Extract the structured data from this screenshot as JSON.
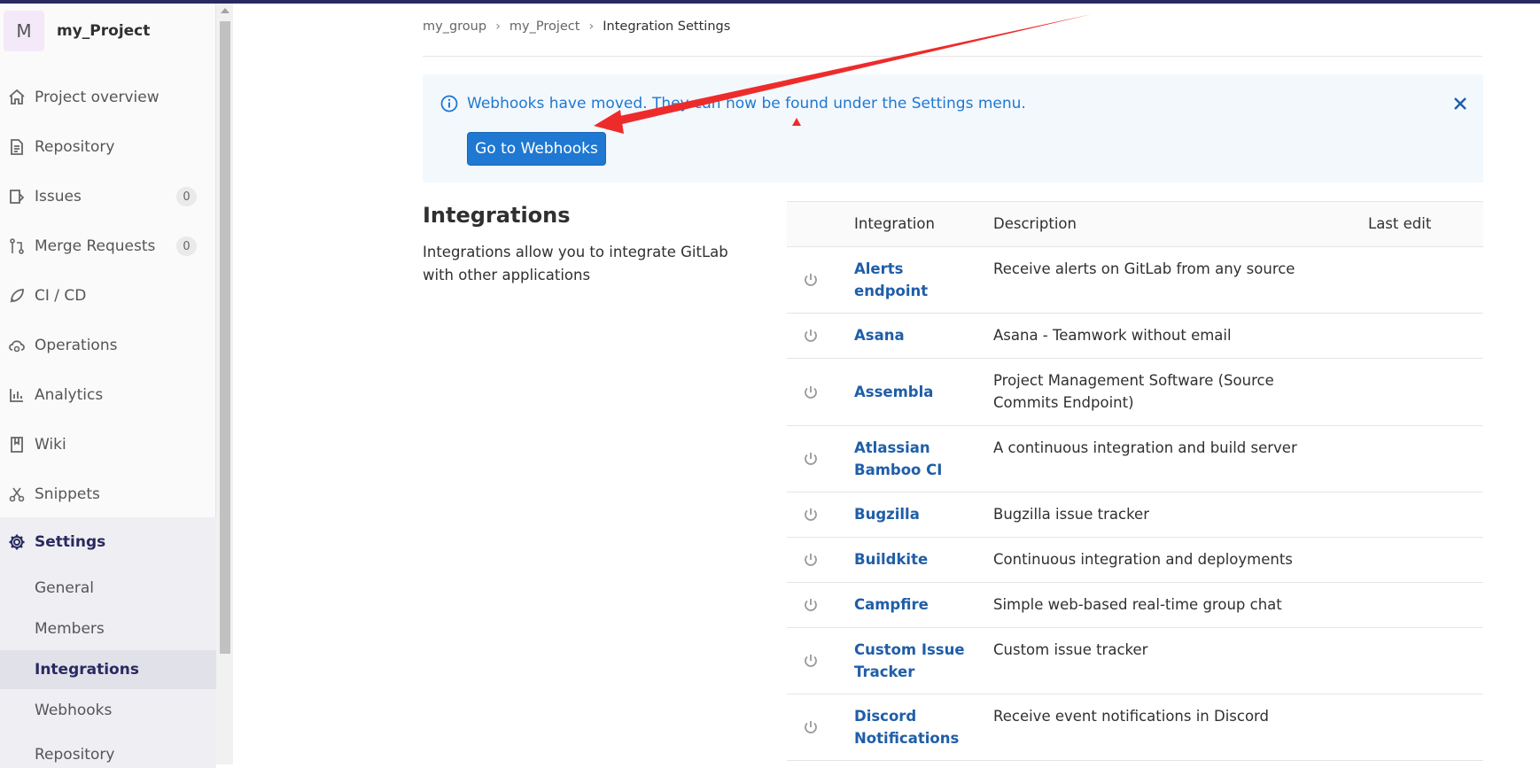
{
  "sidebar": {
    "avatar_letter": "M",
    "project_name": "my_Project",
    "items": [
      {
        "label": "Project overview",
        "icon": "home-icon"
      },
      {
        "label": "Repository",
        "icon": "doc-icon"
      },
      {
        "label": "Issues",
        "icon": "issues-icon",
        "count": "0"
      },
      {
        "label": "Merge Requests",
        "icon": "merge-request-icon",
        "count": "0"
      },
      {
        "label": "CI / CD",
        "icon": "rocket-icon"
      },
      {
        "label": "Operations",
        "icon": "cloud-gear-icon"
      },
      {
        "label": "Analytics",
        "icon": "chart-icon"
      },
      {
        "label": "Wiki",
        "icon": "book-icon"
      },
      {
        "label": "Snippets",
        "icon": "scissors-icon"
      }
    ],
    "settings": {
      "label": "Settings",
      "icon": "gear-icon",
      "subitems": [
        "General",
        "Members",
        "Integrations",
        "Webhooks",
        "Repository"
      ],
      "active": "Integrations"
    }
  },
  "breadcrumb": [
    "my_group",
    "my_Project",
    "Integration Settings"
  ],
  "alert": {
    "text": "Webhooks have moved. They can now be found under the Settings menu.",
    "button": "Go to Webhooks"
  },
  "section": {
    "title": "Integrations",
    "description": "Integrations allow you to integrate GitLab with other applications"
  },
  "table": {
    "headers": [
      "Integration",
      "Description",
      "Last edit"
    ],
    "rows": [
      {
        "name": "Alerts endpoint",
        "description": "Receive alerts on GitLab from any source"
      },
      {
        "name": "Asana",
        "description": "Asana - Teamwork without email"
      },
      {
        "name": "Assembla",
        "description": "Project Management Software (Source Commits Endpoint)"
      },
      {
        "name": "Atlassian Bamboo CI",
        "description": "A continuous integration and build server"
      },
      {
        "name": "Bugzilla",
        "description": "Bugzilla issue tracker"
      },
      {
        "name": "Buildkite",
        "description": "Continuous integration and deployments"
      },
      {
        "name": "Campfire",
        "description": "Simple web-based real-time group chat"
      },
      {
        "name": "Custom Issue Tracker",
        "description": "Custom issue tracker"
      },
      {
        "name": "Discord Notifications",
        "description": "Receive event notifications in Discord"
      }
    ]
  },
  "colors": {
    "brand": "#292961",
    "link": "#1f78d1",
    "annotation": "#ee2b2b"
  }
}
